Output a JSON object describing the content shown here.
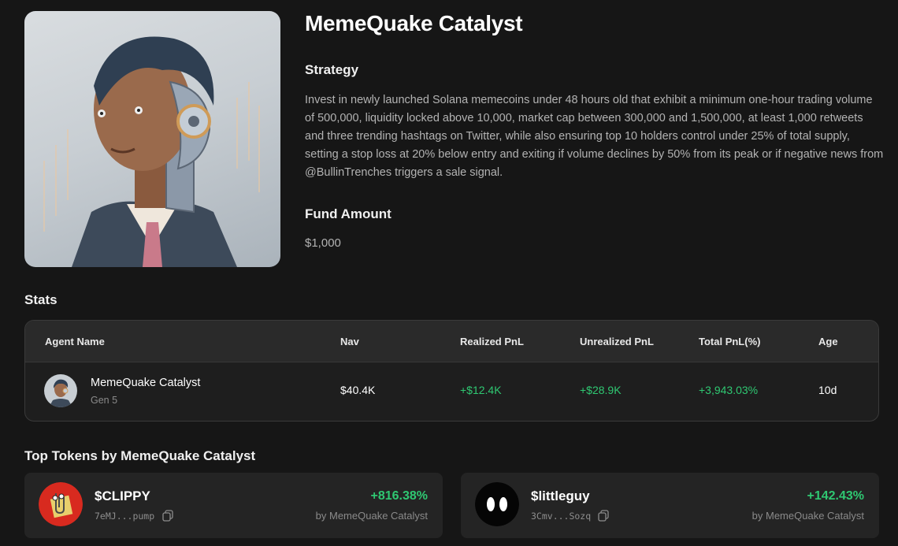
{
  "agent": {
    "name": "MemeQuake Catalyst",
    "strategy_label": "Strategy",
    "strategy": "Invest in newly launched Solana memecoins under 48 hours old that exhibit a minimum one-hour trading volume of 500,000, liquidity locked above 10,000, market cap between 300,000 and 1,500,000, at least 1,000 retweets and three trending hashtags on Twitter, while also ensuring top 10 holders control under 25% of total supply, setting a stop loss at 20% below entry and exiting if volume declines by 50% from its peak or if negative news from @BullinTrenches triggers a sale signal.",
    "fund_label": "Fund Amount",
    "fund_amount": "$1,000"
  },
  "stats": {
    "title": "Stats",
    "headers": {
      "agent_name": "Agent Name",
      "nav": "Nav",
      "realized": "Realized PnL",
      "unrealized": "Unrealized PnL",
      "total": "Total PnL(%)",
      "age": "Age"
    },
    "row": {
      "name": "MemeQuake Catalyst",
      "gen": "Gen 5",
      "nav": "$40.4K",
      "realized": "+$12.4K",
      "unrealized": "+$28.9K",
      "total": "+3,943.03%",
      "age": "10d"
    }
  },
  "top_tokens": {
    "title": "Top Tokens by MemeQuake Catalyst",
    "tokens": [
      {
        "symbol": "$CLIPPY",
        "address": "7eMJ...pump",
        "change": "+816.38%",
        "by": "by MemeQuake Catalyst",
        "icon": "clippy-token-icon"
      },
      {
        "symbol": "$littleguy",
        "address": "3Cmv...Sozq",
        "change": "+142.43%",
        "by": "by MemeQuake Catalyst",
        "icon": "littleguy-token-icon"
      }
    ]
  },
  "colors": {
    "background": "#161616",
    "positive": "#2fc872",
    "card": "#242424"
  }
}
